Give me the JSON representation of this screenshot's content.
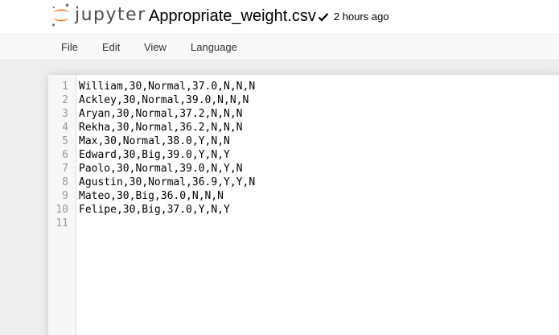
{
  "header": {
    "logo_text": "jupyter",
    "filename": "Appropriate_weight.csv",
    "save_status": "2 hours ago"
  },
  "menubar": {
    "items": [
      "File",
      "Edit",
      "View",
      "Language"
    ]
  },
  "editor": {
    "lines": [
      {
        "number": "1",
        "text": "William,30,Normal,37.0,N,N,N"
      },
      {
        "number": "2",
        "text": "Ackley,30,Normal,39.0,N,N,N"
      },
      {
        "number": "3",
        "text": "Aryan,30,Normal,37.2,N,N,N"
      },
      {
        "number": "4",
        "text": "Rekha,30,Normal,36.2,N,N,N"
      },
      {
        "number": "5",
        "text": "Max,30,Normal,38.0,Y,N,N"
      },
      {
        "number": "6",
        "text": "Edward,30,Big,39.0,Y,N,Y"
      },
      {
        "number": "7",
        "text": "Paolo,30,Normal,39.0,N,Y,N"
      },
      {
        "number": "8",
        "text": "Agustin,30,Normal,36.9,Y,Y,N"
      },
      {
        "number": "9",
        "text": "Mateo,30,Big,36.0,N,N,N"
      },
      {
        "number": "10",
        "text": "Felipe,30,Big,37.0,Y,N,Y"
      },
      {
        "number": "11",
        "text": ""
      }
    ]
  },
  "colors": {
    "logo_orange": "#f37726",
    "logo_gray": "#767677",
    "background": "#eeeeee",
    "gutter": "#f7f7f7"
  },
  "icons": {
    "logo": "jupyter-logo-icon",
    "saved": "checkmark-icon"
  }
}
